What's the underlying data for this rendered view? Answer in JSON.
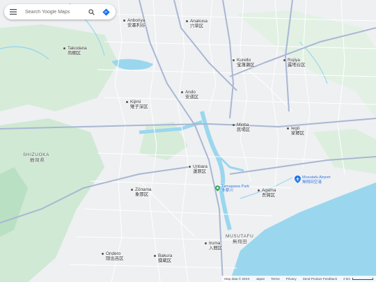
{
  "search": {
    "placeholder": "Search Yoogle Maps"
  },
  "icons": {
    "menu": "menu-icon",
    "search": "search-icon",
    "directions": "directions-icon",
    "airport": "airport-icon"
  },
  "colors": {
    "water": "#9ad7ee",
    "park": "#cfe9d4",
    "land": "#eef0f2",
    "road": "#ffffff",
    "major_road": "#aab6d3",
    "brand": "#1a73e8"
  },
  "places": [
    {
      "name": "Anboriya",
      "kanji": "安墨利谷"
    },
    {
      "name": "Anakusa",
      "kanji": "穴草区"
    },
    {
      "name": "Takodana",
      "kanji": "尚棚区"
    },
    {
      "name": "Kurelto",
      "kanji": "宝蓮瀬区"
    },
    {
      "name": "Rojiya",
      "kanji": "露地谷区"
    },
    {
      "name": "Ando",
      "kanji": "安道区"
    },
    {
      "name": "Kijimi",
      "kanji": "雉子深区"
    },
    {
      "name": "Minba",
      "kanji": "民場区"
    },
    {
      "name": "Iegō",
      "kanji": "家郷区"
    },
    {
      "name": "Unbara",
      "kanji": "運原区"
    },
    {
      "name": "Zōnama",
      "kanji": "象那区"
    },
    {
      "name": "Agama",
      "kanji": "吾賀区"
    },
    {
      "name": "Ondero",
      "kanji": "隠出呂区"
    },
    {
      "name": "Bakura",
      "kanji": "獏蔵区"
    },
    {
      "name": "Iruma",
      "kanji": "入間区"
    }
  ],
  "regions": [
    {
      "name": "SHIZUOKA",
      "kanji": "静岡県"
    },
    {
      "name": "MUSUTAFU",
      "kanji": "無翔田"
    }
  ],
  "pois": [
    {
      "name": "Musutafu Airport",
      "kanji": "無翔田空港"
    },
    {
      "name": "Tamagawa Park",
      "kanji": "多摩川"
    }
  ],
  "footer": {
    "map_data": "Map data © 20XX",
    "japan": "Japan",
    "terms": "Terms",
    "privacy": "Privacy",
    "feedback": "Send Product Feedback",
    "scale": "2 km"
  }
}
